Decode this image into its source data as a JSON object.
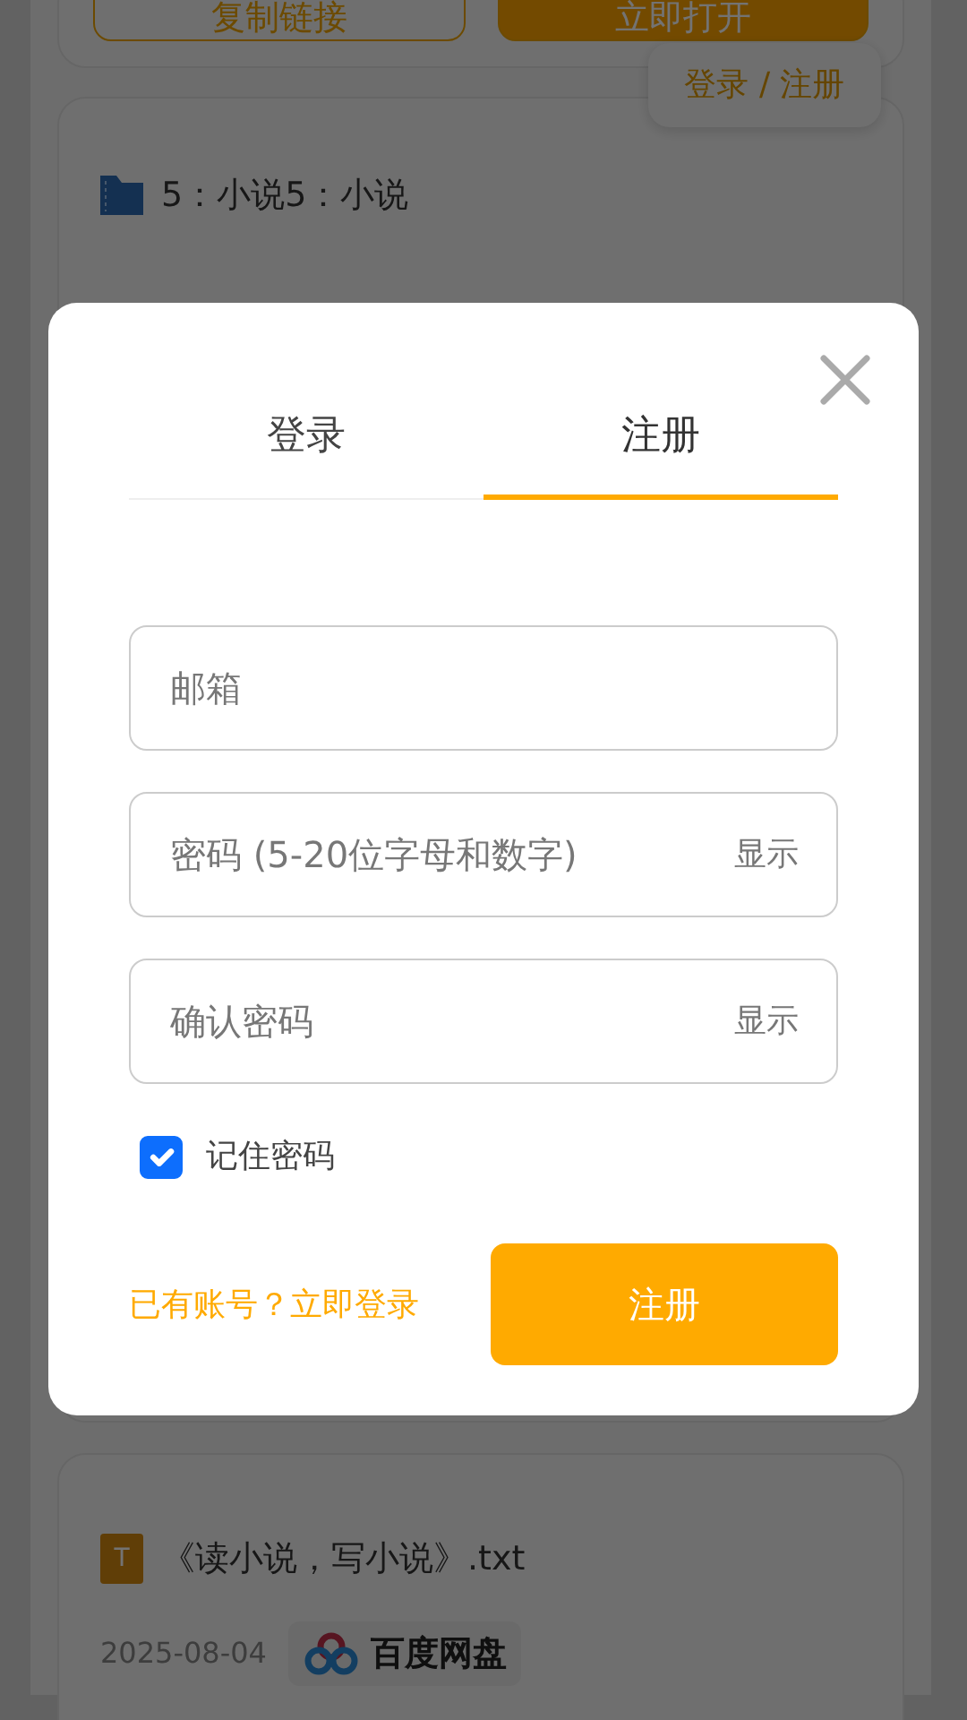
{
  "page": {
    "top_card": {
      "buttons": [
        {
          "label": "复制链接",
          "kind": "outline"
        },
        {
          "label": "立即打开",
          "kind": "filled"
        }
      ]
    },
    "floating_button": {
      "label": "登录 / 注册"
    },
    "file_cards": [
      {
        "kind": "folder",
        "name": "5：小说5：小说"
      },
      {
        "kind": "text",
        "icon_letter": "T",
        "name": "《读小说，写小说》.txt",
        "date": "2025-08-04",
        "source": "百度网盘"
      }
    ]
  },
  "dialog": {
    "tabs": [
      {
        "label": "登录",
        "selected": false
      },
      {
        "label": "注册",
        "selected": true
      }
    ],
    "fields": [
      {
        "placeholder": "邮箱"
      },
      {
        "placeholder": "密码 (5-20位字母和数字)",
        "toggle": "显示"
      },
      {
        "placeholder": "确认密码",
        "toggle": "显示"
      }
    ],
    "remember": {
      "label": "记住密码",
      "checked": true
    },
    "switch_link": "已有账号？立即登录",
    "submit": "注册"
  }
}
